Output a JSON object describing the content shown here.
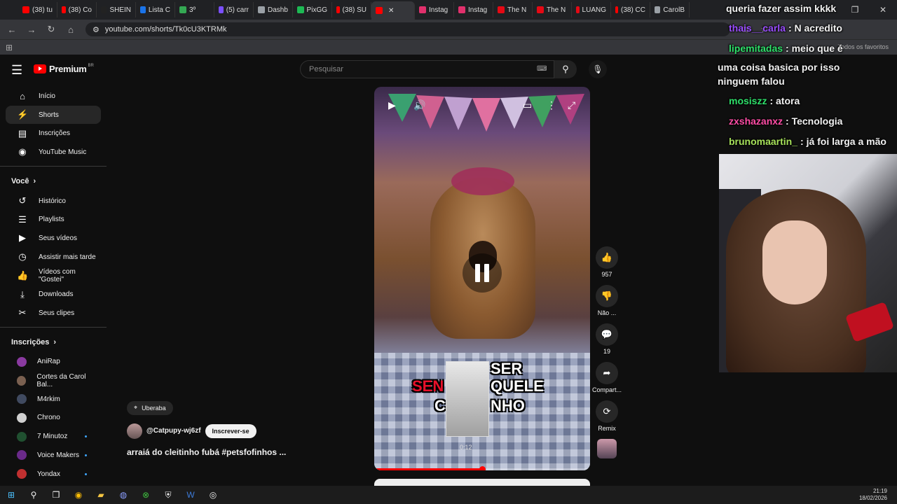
{
  "browser": {
    "tabs": [
      {
        "label": "(38) tu",
        "color": "#ff0000"
      },
      {
        "label": "(38) Co",
        "color": "#ff0000"
      },
      {
        "label": "SHEIN",
        "color": "#222222"
      },
      {
        "label": "Lista C",
        "color": "#1a73e8"
      },
      {
        "label": "3º",
        "color": "#34a853"
      },
      {
        "label": "(5) carr",
        "color": "#7b4fff"
      },
      {
        "label": "Dashb",
        "color": "#9aa0a6"
      },
      {
        "label": "PixGG",
        "color": "#1db954"
      },
      {
        "label": "(38) SU",
        "color": "#ff0000"
      },
      {
        "label": "",
        "color": "#ff0000",
        "active": true
      },
      {
        "label": "Instag",
        "color": "#e1306c"
      },
      {
        "label": "Instag",
        "color": "#e1306c"
      },
      {
        "label": "The N",
        "color": "#e50914"
      },
      {
        "label": "The N",
        "color": "#e50914"
      },
      {
        "label": "LUANG",
        "color": "#e50914"
      },
      {
        "label": "(38) CC",
        "color": "#ff0000"
      },
      {
        "label": "CarolB",
        "color": "#9aa0a6"
      }
    ],
    "url": "youtube.com/shorts/Tk0cU3KTRMk",
    "bookmark_right": "Todos os favoritos"
  },
  "yt": {
    "logo_text": "Premium",
    "region": "BR",
    "search_placeholder": "Pesquisar",
    "sidebar_main": [
      {
        "label": "Início",
        "icon": "⌂",
        "name": "home"
      },
      {
        "label": "Shorts",
        "icon": "⚡",
        "name": "shorts",
        "active": true
      },
      {
        "label": "Inscrições",
        "icon": "▤",
        "name": "subscriptions"
      },
      {
        "label": "YouTube Music",
        "icon": "◉",
        "name": "youtube-music"
      }
    ],
    "you_header": "Você",
    "sidebar_you": [
      {
        "label": "Histórico",
        "icon": "↺",
        "name": "history"
      },
      {
        "label": "Playlists",
        "icon": "☰",
        "name": "playlists"
      },
      {
        "label": "Seus vídeos",
        "icon": "▶",
        "name": "your-videos"
      },
      {
        "label": "Assistir mais tarde",
        "icon": "◷",
        "name": "watch-later"
      },
      {
        "label": "Vídeos com \"Gostei\"",
        "icon": "👍",
        "name": "liked-videos"
      },
      {
        "label": "Downloads",
        "icon": "⤓",
        "name": "downloads"
      },
      {
        "label": "Seus clipes",
        "icon": "✂",
        "name": "your-clips"
      }
    ],
    "subs_header": "Inscrições",
    "subscriptions": [
      {
        "label": "AniRap",
        "color": "#8a3aa0",
        "dot": false
      },
      {
        "label": "Cortes da Carol Bal...",
        "color": "#7a6050",
        "dot": false
      },
      {
        "label": "M4rkim",
        "color": "#404a60",
        "dot": false
      },
      {
        "label": "Chrono",
        "color": "#d0d0d0",
        "dot": false
      },
      {
        "label": "7 Minutoz",
        "color": "#205030",
        "dot": true
      },
      {
        "label": "Voice Makers",
        "color": "#6a2a8a",
        "dot": true
      },
      {
        "label": "Yondax",
        "color": "#c03030",
        "dot": true
      }
    ]
  },
  "short": {
    "caption_parts": [
      "SER",
      "SEN",
      "QUELE",
      "C",
      "NHO"
    ],
    "preview_time": "0:12",
    "progress_fraction": 0.5,
    "location": "Uberaba",
    "channel": "@Catpupy-wj6zf",
    "subscribe": "Inscrever-se",
    "title": "arraiá do cleitinho fubá #petsfofinhos ...",
    "actions": {
      "likes": "957",
      "dislike": "Não ...",
      "comments": "19",
      "share": "Compart...",
      "remix": "Remix"
    }
  },
  "stream_chat": [
    {
      "user": "",
      "text": "queria fazer assim kkkk",
      "color": "#ffffff"
    },
    {
      "user": "thais__carla",
      "text": ": N acredito",
      "color": "#9a4dff"
    },
    {
      "user": "lipemitadas",
      "text": ": meio que é",
      "color": "#2ee06a"
    },
    {
      "user": "",
      "text": "uma coisa basica por isso",
      "color": "#ffffff"
    },
    {
      "user": "",
      "text": "ninguem falou",
      "color": "#ffffff"
    },
    {
      "user": "mosiszz",
      "text": ": atora",
      "color": "#2ee06a"
    },
    {
      "user": "zxshazanxz",
      "text": ": Tecnologia",
      "color": "#ff4da6"
    },
    {
      "user": "brunomaartin_",
      "text": ": já foi larga a mão",
      "color": "#a6e05a"
    }
  ],
  "taskbar": {
    "time": "21:19",
    "date": "18/02/2026"
  }
}
